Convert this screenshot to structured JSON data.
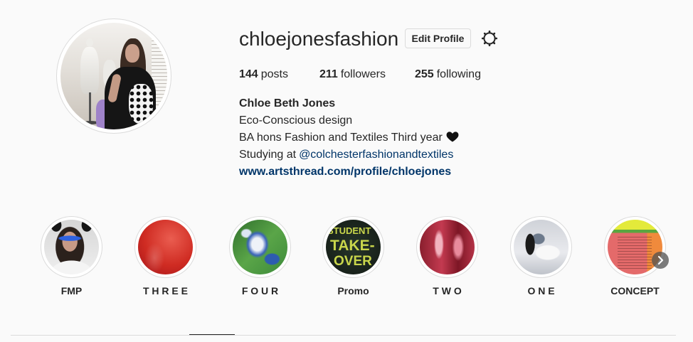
{
  "profile": {
    "username": "chloejonesfashion",
    "edit_profile_label": "Edit Profile",
    "settings_icon": "gear-icon",
    "stats": {
      "posts": {
        "count": "144",
        "label": "posts"
      },
      "followers": {
        "count": "211",
        "label": "followers"
      },
      "following": {
        "count": "255",
        "label": "following"
      }
    },
    "bio": {
      "full_name": "Chloe Beth Jones",
      "line_1": "Eco-Conscious design",
      "line_2": "BA hons Fashion and Textiles Third year",
      "line_2_emoji_icon": "black-heart-icon",
      "line_3_prefix": "Studying at",
      "line_3_mention": "@colchesterfashionandtextiles",
      "website": "www.artsthread.com/profile/chloejones"
    }
  },
  "highlights": [
    {
      "title": "FMP"
    },
    {
      "title": "T H R E E"
    },
    {
      "title": "F O U R"
    },
    {
      "title": "Promo",
      "cover_text": [
        "STUDENT",
        "TAKE-",
        "OVER"
      ]
    },
    {
      "title": "T W O"
    },
    {
      "title": "O N E"
    },
    {
      "title": "CONCEPT"
    }
  ],
  "highlights_next_icon": "chevron-right-icon",
  "colors": {
    "page_background": "#fafafa",
    "text": "#262626",
    "link": "#003569",
    "border": "#dbdbdb"
  }
}
